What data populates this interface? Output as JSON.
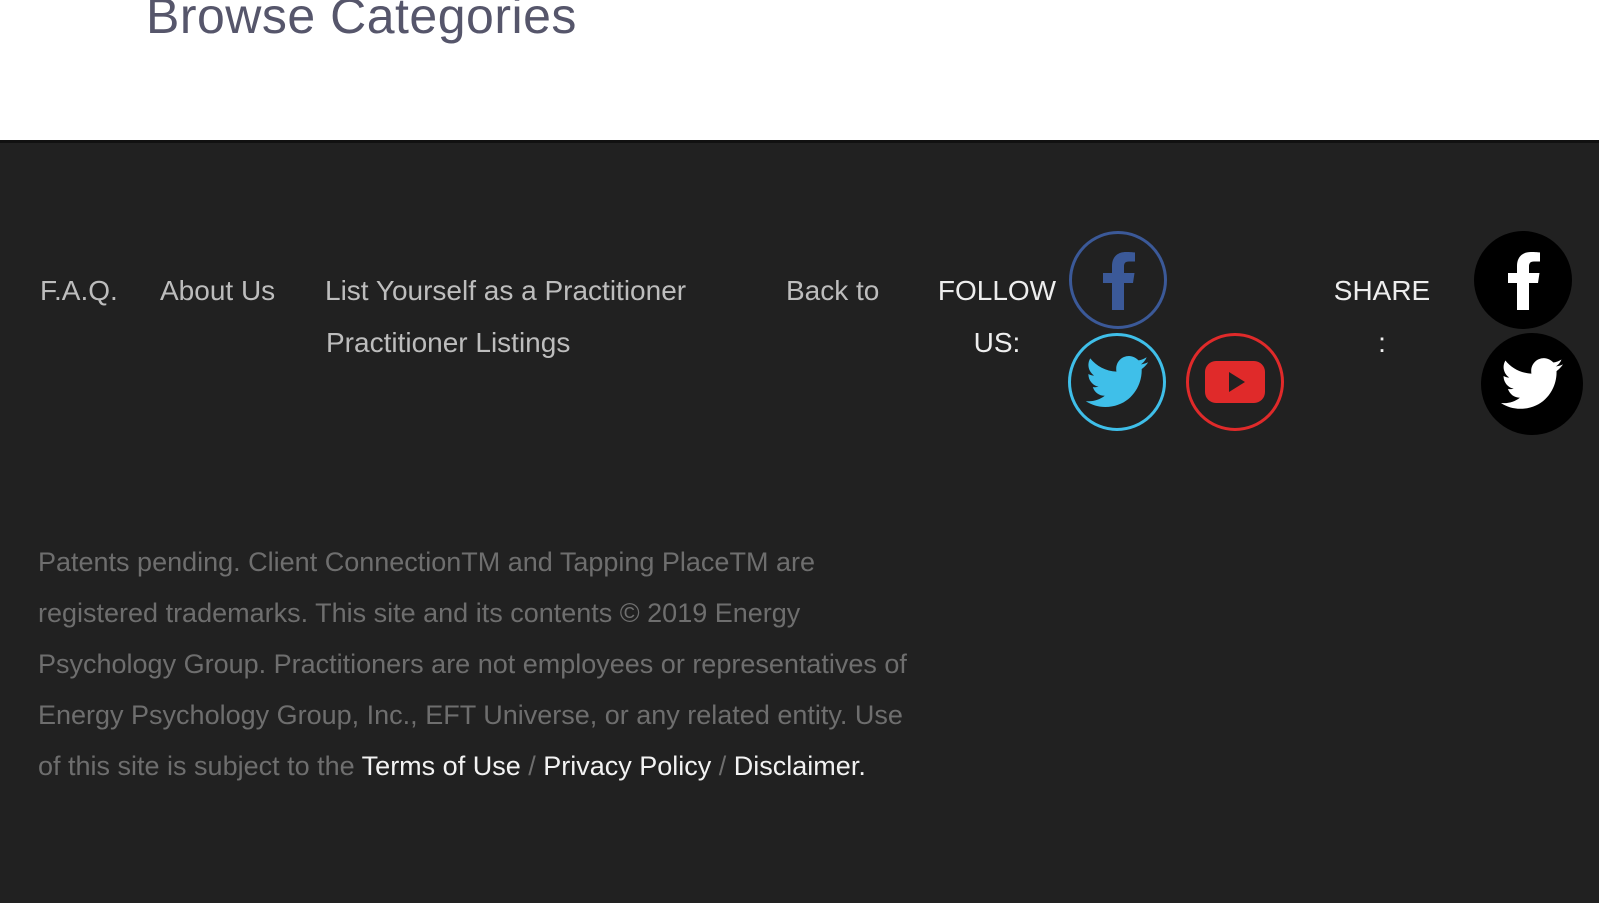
{
  "header": {
    "browse_title": "Browse Categories",
    "menu_icon": "hamburger-menu-icon"
  },
  "footer": {
    "nav": [
      {
        "label": "F.A.Q."
      },
      {
        "label": "About Us"
      },
      {
        "label": "List Yourself as a Practitioner"
      },
      {
        "label": "Back to"
      },
      {
        "label": "Practitioner Listings"
      }
    ],
    "follow_label_line1": "FOLLOW",
    "follow_label_line2": "US:",
    "follow_icons": [
      "facebook-icon",
      "twitter-icon",
      "youtube-icon"
    ],
    "share_label_line1": "SHARE",
    "share_label_line2": ":",
    "share_icons": [
      "facebook-icon",
      "twitter-icon"
    ],
    "legal": {
      "text": "Patents pending. Client ConnectionTM and Tapping PlaceTM are registered trademarks. This site and its contents © 2019 Energy Psychology Group. Practitioners are not employees or representatives of Energy Psychology Group, Inc., EFT Universe, or any related entity. Use of this site is subject to the ",
      "terms_link": "Terms of Use",
      "sep1": " / ",
      "privacy_link": "Privacy Policy",
      "sep2": " / ",
      "disclaimer_link": "Disclaimer."
    }
  },
  "colors": {
    "footer_bg": "#212121",
    "accent_green": "#8cc63f",
    "facebook": "#3b5998",
    "twitter": "#3fbfe9",
    "youtube": "#e02a2a"
  }
}
